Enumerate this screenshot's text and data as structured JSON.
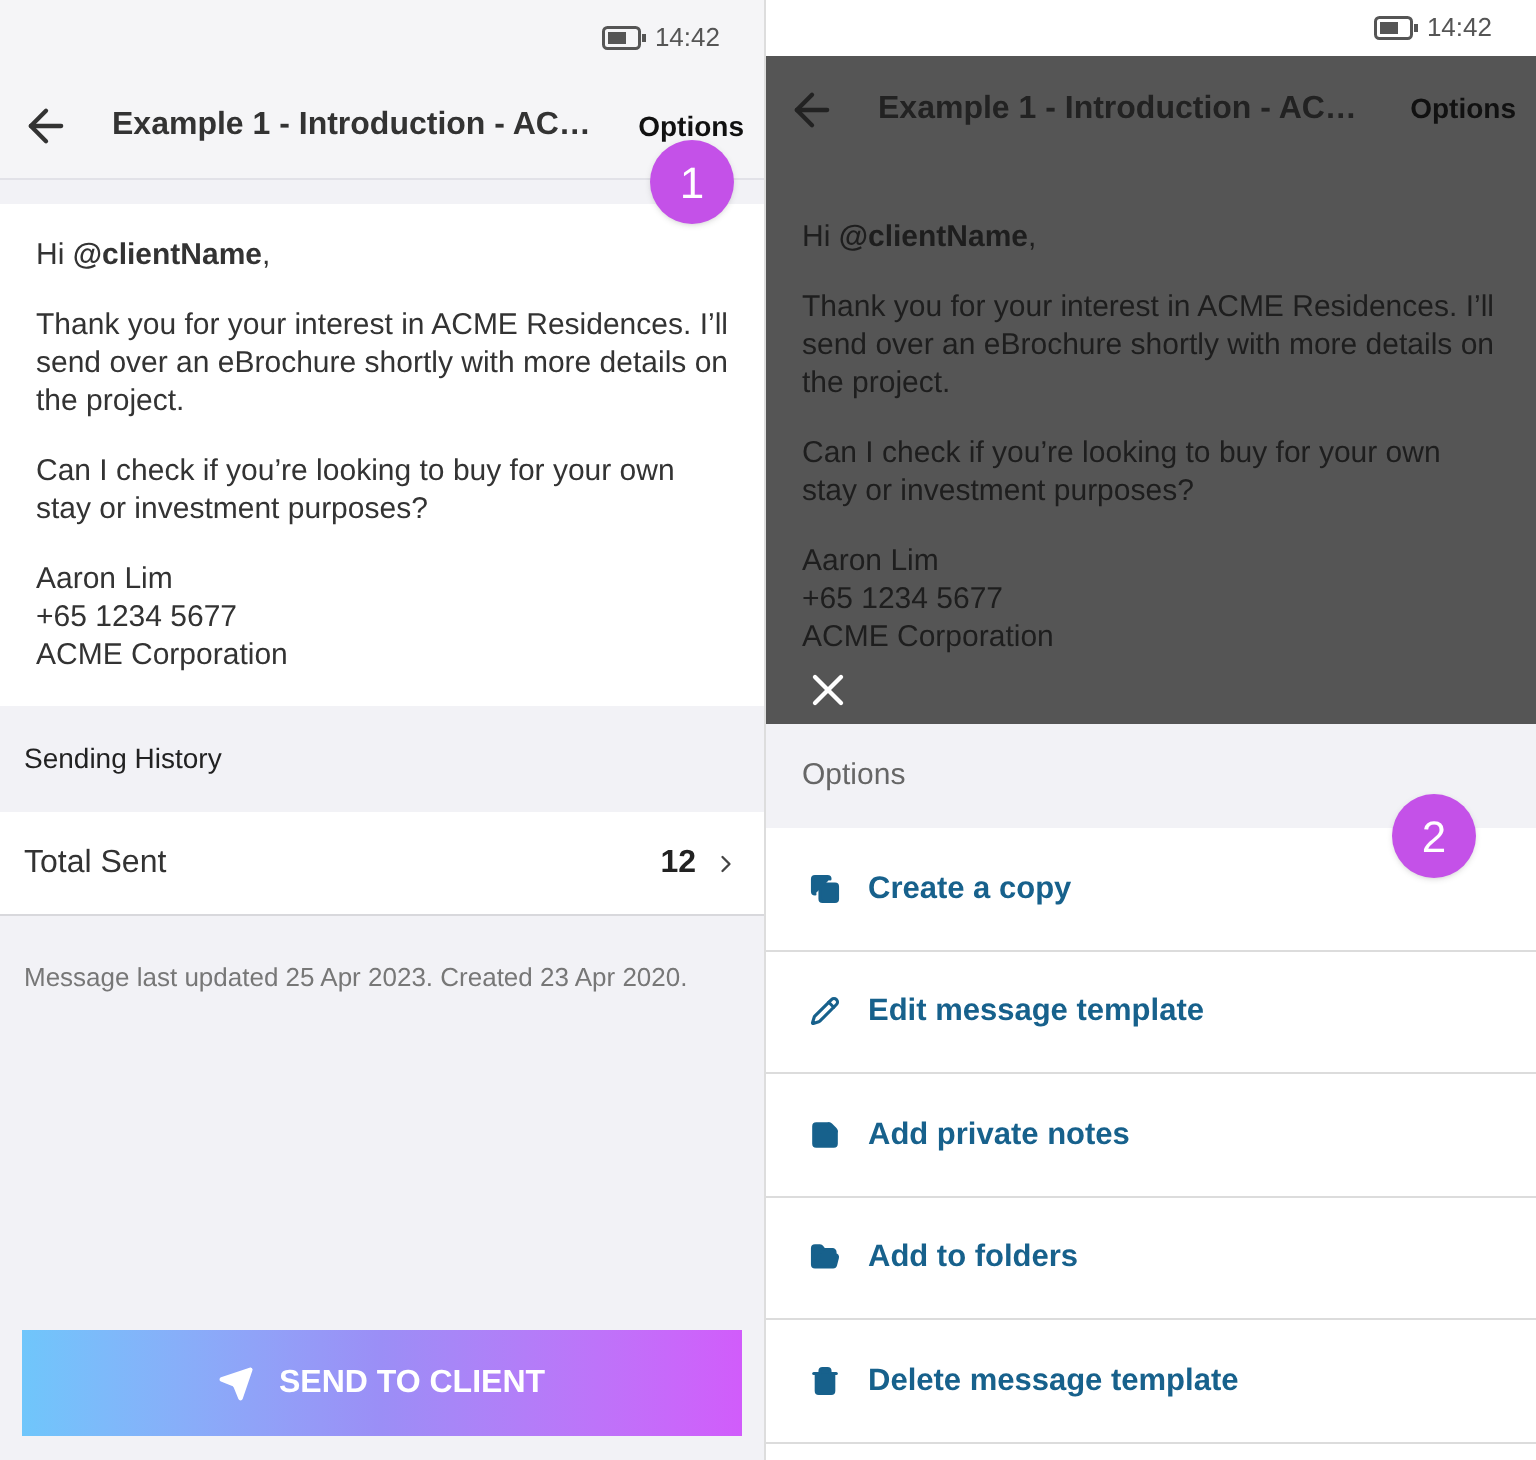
{
  "left": {
    "status_bar": {
      "time": "14:42"
    },
    "header": {
      "title": "Example 1 - Introduction - AC…",
      "action": "Options"
    },
    "message": {
      "greeting": "Hi **@clientName**,",
      "paragraphs": [
        "Thank you for your interest in ACME Residences. I’ll send over an eBrochure shortly with more details on the project.",
        "Can I check if you’re looking to buy for your own stay or investment purposes?"
      ],
      "signature": [
        "Aaron Lim",
        "+65 1234 5677",
        "ACME Corporation"
      ]
    },
    "sending_history": {
      "title": "Sending History",
      "rows": [
        {
          "label": "Total Sent",
          "value": "12"
        }
      ]
    },
    "note": "Message last updated 25 Apr 2023. Created 23 Apr 2020.",
    "send_button": "SEND TO CLIENT"
  },
  "right": {
    "status_bar": {
      "time": "14:42"
    },
    "header": {
      "title": "Example 1 - Introduction - AC…",
      "action": "Options"
    },
    "message": {
      "greeting": "Hi **@clientName**,",
      "paragraphs": [
        "Thank you for your interest in ACME Residences. I’ll send over an eBrochure shortly with more details on the project.",
        "Can I check if you’re looking to buy for your own stay or investment purposes?"
      ],
      "signature": [
        "Aaron Lim",
        "+65 1234 5677",
        "ACME Corporation"
      ]
    },
    "sheet": {
      "title": "Options",
      "items": [
        {
          "kind": "copy",
          "label": "Create a copy"
        },
        {
          "kind": "edit",
          "label": "Edit message template"
        },
        {
          "kind": "note",
          "label": "Add private notes"
        },
        {
          "kind": "folder",
          "label": "Add to folders"
        },
        {
          "kind": "delete",
          "label": "Delete message template"
        }
      ]
    }
  },
  "callouts": [
    {
      "label": "1"
    },
    {
      "label": "2"
    }
  ]
}
